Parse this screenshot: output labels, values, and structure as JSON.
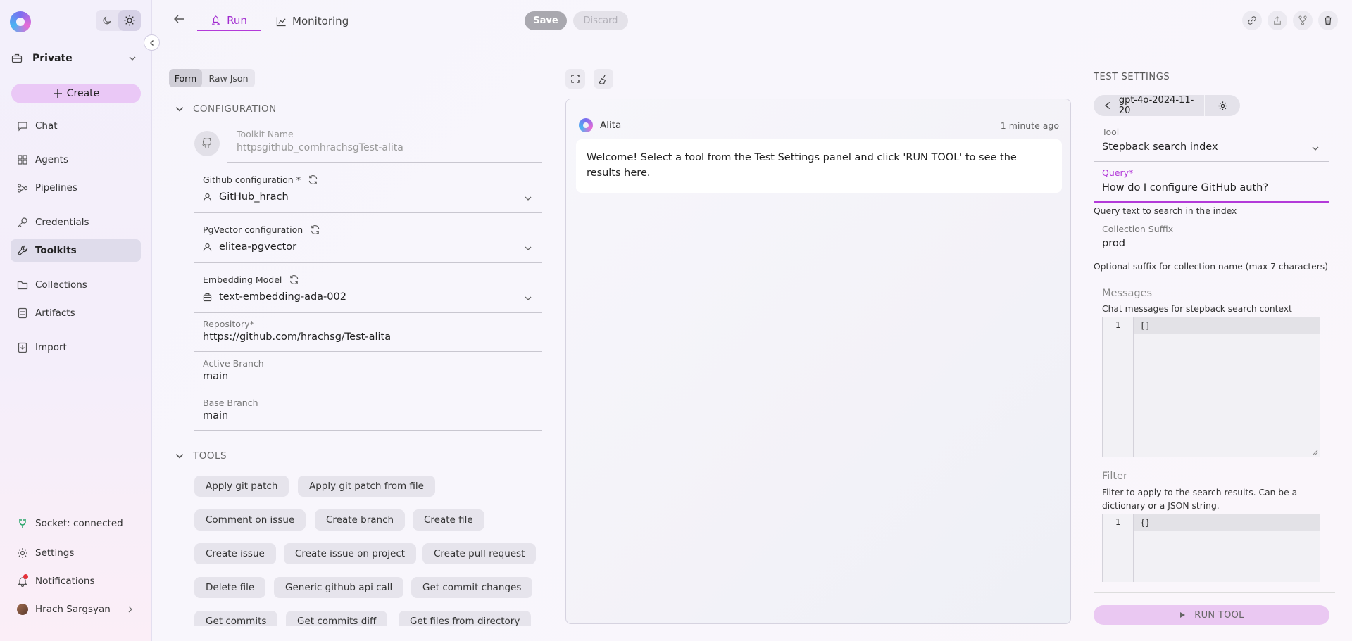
{
  "sidebar": {
    "project": "Private",
    "create_label": "Create",
    "nav": [
      {
        "label": "Chat"
      },
      {
        "label": "Agents"
      },
      {
        "label": "Pipelines"
      },
      {
        "label": "Credentials"
      },
      {
        "label": "Toolkits"
      },
      {
        "label": "Collections"
      },
      {
        "label": "Artifacts"
      },
      {
        "label": "Import"
      }
    ],
    "active_nav": "Toolkits",
    "socket_status": "Socket: connected",
    "settings_label": "Settings",
    "notifications_label": "Notifications",
    "user_name": "Hrach Sargsyan",
    "accent_color": "#eac8f6"
  },
  "topbar": {
    "tabs": [
      {
        "label": "Run"
      },
      {
        "label": "Monitoring"
      }
    ],
    "active_tab": "Run",
    "save_label": "Save",
    "discard_label": "Discard"
  },
  "form": {
    "toggle": {
      "form": "Form",
      "raw": "Raw Json"
    },
    "configuration_title": "CONFIGURATION",
    "toolkit_name": {
      "label": "Toolkit Name",
      "value": "httpsgithub_comhrachsgTest-alita"
    },
    "github_config": {
      "label": "Github configuration *",
      "value": "GitHub_hrach"
    },
    "pgvector_config": {
      "label": "PgVector configuration",
      "value": "elitea-pgvector"
    },
    "embedding_model": {
      "label": "Embedding Model",
      "value": "text-embedding-ada-002"
    },
    "repository": {
      "label": "Repository*",
      "value": "https://github.com/hrachsg/Test-alita"
    },
    "active_branch": {
      "label": "Active Branch",
      "value": "main"
    },
    "base_branch": {
      "label": "Base Branch",
      "value": "main"
    },
    "tools_title": "TOOLS",
    "tools": [
      "Apply git patch",
      "Apply git patch from file",
      "Comment on issue",
      "Create branch",
      "Create file",
      "Create issue",
      "Create issue on project",
      "Create pull request",
      "Delete file",
      "Generic github api call",
      "Get commit changes",
      "Get commits",
      "Get commits diff",
      "Get files from directory"
    ]
  },
  "chat": {
    "author": "Alita",
    "time": "1 minute ago",
    "message": "Welcome! Select a tool from the Test Settings panel and click 'RUN TOOL' to see the results here."
  },
  "test_settings": {
    "title": "TEST SETTINGS",
    "model": "gpt-4o-2024-11-20",
    "tool": {
      "label": "Tool",
      "value": "Stepback search index"
    },
    "query": {
      "label": "Query",
      "required_mark": "*",
      "value": "How do I configure GitHub auth?",
      "help": "Query text to search in the index"
    },
    "collection_suffix": {
      "label": "Collection Suffix",
      "value": "prod",
      "help": "Optional suffix for collection name (max 7 characters)"
    },
    "messages": {
      "label": "Messages",
      "help": "Chat messages for stepback search context",
      "line_no": "1",
      "code": "[]"
    },
    "filter": {
      "label": "Filter",
      "help": "Filter to apply to the search results. Can be a dictionary or a JSON string.",
      "line_no": "1",
      "code": "{}"
    },
    "run_label": "RUN TOOL",
    "query_accent": "#b33ad9"
  }
}
